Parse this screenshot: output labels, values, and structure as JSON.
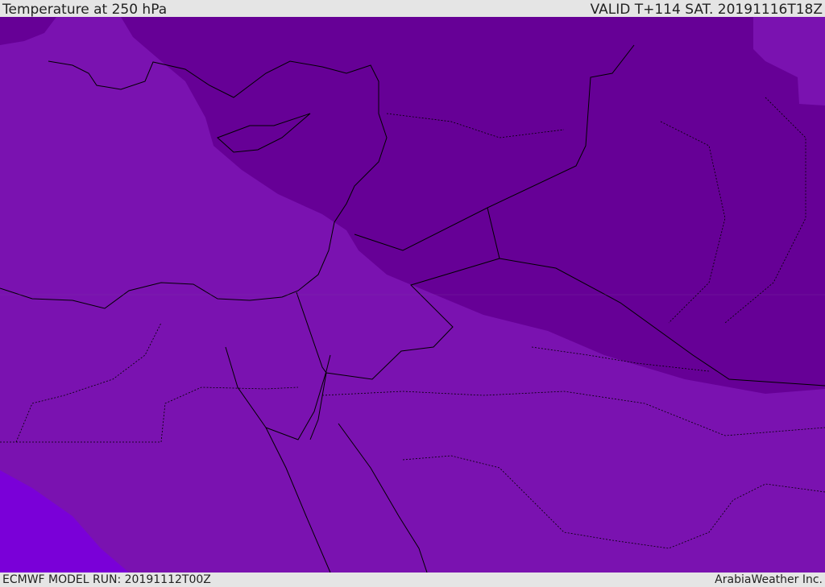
{
  "header": {
    "title": "Temperature at 250 hPa",
    "valid": "VALID T+114 SAT. 20191116T18Z"
  },
  "footer": {
    "model_run": "ECMWF MODEL RUN: 20191112T00Z",
    "credit": "ArabiaWeather Inc."
  },
  "map": {
    "colors": {
      "mid_band": "#7a12b0",
      "cold_band": "#660096",
      "warm_band": "#7a00d8",
      "border": "#000000"
    }
  }
}
